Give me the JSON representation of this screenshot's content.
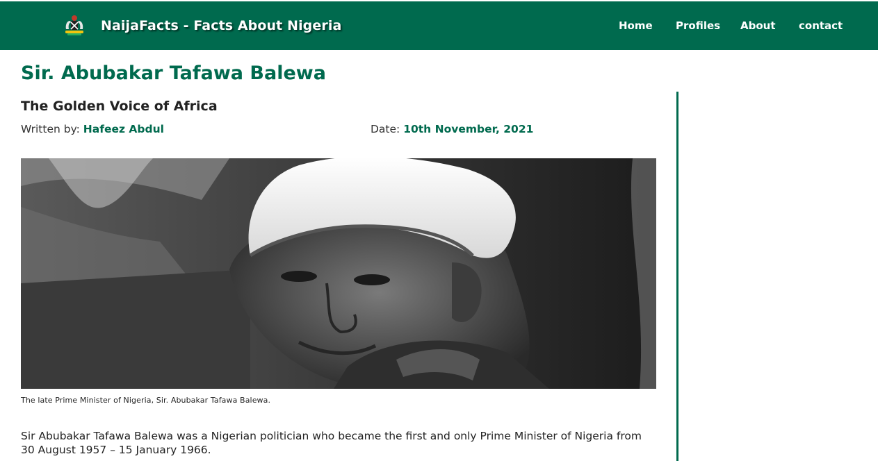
{
  "header": {
    "brand": "NaijaFacts - Facts About Nigeria",
    "logo_icon": "nigeria-coat-of-arms-icon",
    "nav": [
      "Home",
      "Profiles",
      "About",
      "contact"
    ],
    "bg_color": "#006a4e"
  },
  "article": {
    "title": "Sir. Abubakar Tafawa Balewa",
    "subtitle": "The Golden Voice of Africa",
    "author_label": "Written by: ",
    "author": "Hafeez Abdul",
    "date_label": "Date: ",
    "date": "10th November, 2021",
    "image_caption": "The late Prime Minister of Nigeria, Sir. Abubakar Tafawa Balewa.",
    "paragraph": "Sir Abubakar Tafawa Balewa was a Nigerian politician who became the first and only Prime Minister of Nigeria from 30 August 1957 – 15 January 1966."
  },
  "colors": {
    "accent": "#006a4e",
    "text": "#222222"
  }
}
